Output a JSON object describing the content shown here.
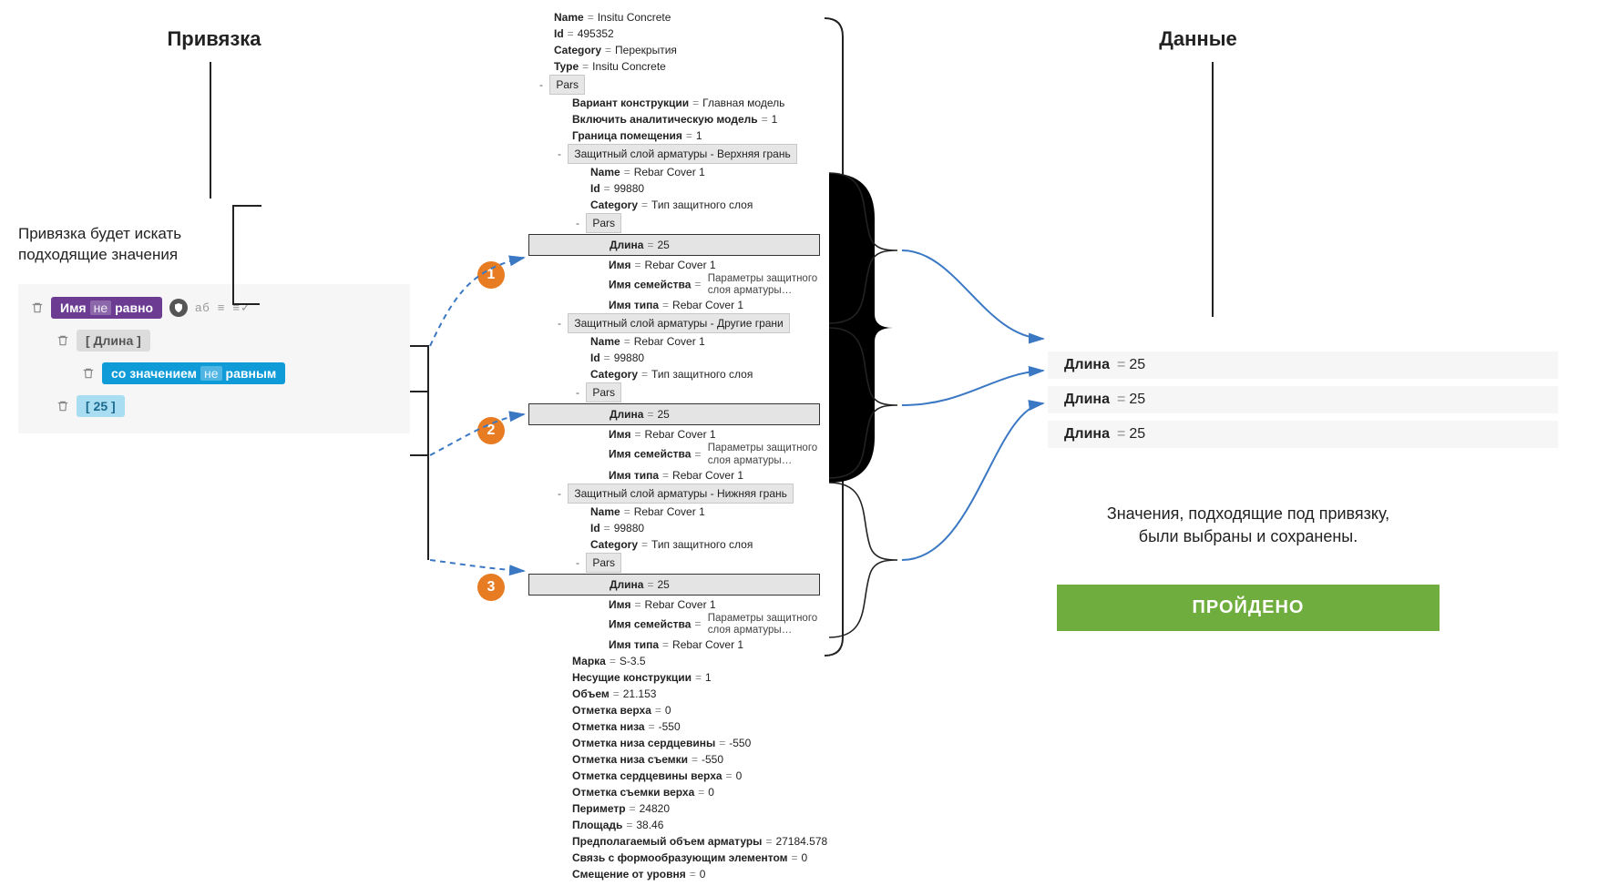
{
  "headings": {
    "left": "Привязка",
    "right": "Данные"
  },
  "leftNote": "Привязка будет искать подходящие  значения",
  "rule": {
    "name_label": "Имя",
    "neg": "не",
    "equals": "равно",
    "icons_hint": "аб",
    "field": "[ Длина ]",
    "withValue": "со значением",
    "withValueEquals": "равным",
    "value": "[ 25 ]"
  },
  "steps": [
    "1",
    "2",
    "3"
  ],
  "tree": {
    "name": {
      "k": "Name",
      "v": "Insitu Concrete"
    },
    "id": {
      "k": "Id",
      "v": "495352"
    },
    "cat": {
      "k": "Category",
      "v": "Перекрытия"
    },
    "type": {
      "k": "Type",
      "v": "Insitu Concrete"
    },
    "pars": "Pars",
    "variant": {
      "k": "Вариант конструкции",
      "v": "Главная модель"
    },
    "analytical": {
      "k": "Включить аналитическую модель",
      "v": "1"
    },
    "room": {
      "k": "Граница помещения",
      "v": "1"
    },
    "groups": [
      {
        "title": "Защитный слой арматуры - Верхняя грань"
      },
      {
        "title": "Защитный слой арматуры - Другие грани"
      },
      {
        "title": "Защитный слой арматуры - Нижняя грань"
      }
    ],
    "groupInner": {
      "name": {
        "k": "Name",
        "v": "Rebar Cover 1"
      },
      "id": {
        "k": "Id",
        "v": "99880"
      },
      "cat": {
        "k": "Category",
        "v": "Тип защитного слоя"
      },
      "pars": "Pars",
      "len": {
        "k": "Длина",
        "v": "25"
      },
      "nm": {
        "k": "Имя",
        "v": "Rebar Cover 1"
      },
      "fam": {
        "k": "Имя семейства",
        "v1": "Параметры защитного",
        "v2": "слоя арматуры…"
      },
      "typename": {
        "k": "Имя типа",
        "v": "Rebar Cover 1"
      }
    },
    "tail": [
      {
        "k": "Марка",
        "v": "S-3.5"
      },
      {
        "k": "Несущие конструкции",
        "v": "1"
      },
      {
        "k": "Объем",
        "v": "21.153"
      },
      {
        "k": "Отметка верха",
        "v": "0"
      },
      {
        "k": "Отметка низа",
        "v": "-550"
      },
      {
        "k": "Отметка низа сердцевины",
        "v": "-550"
      },
      {
        "k": "Отметка низа съемки",
        "v": "-550"
      },
      {
        "k": "Отметка сердцевины верха",
        "v": "0"
      },
      {
        "k": "Отметка съемки верха",
        "v": "0"
      },
      {
        "k": "Периметр",
        "v": "24820"
      },
      {
        "k": "Площадь",
        "v": "38.46"
      },
      {
        "k": "Предполагаемый объем арматуры",
        "v": "27184.578"
      },
      {
        "k": "Связь с формообразующим элементом",
        "v": "0"
      },
      {
        "k": "Смещение от уровня",
        "v": "0"
      }
    ]
  },
  "results": [
    {
      "k": "Длина",
      "v": "25"
    },
    {
      "k": "Длина",
      "v": "25"
    },
    {
      "k": "Длина",
      "v": "25"
    }
  ],
  "rightNote1": "Значения, подходящие под привязку,",
  "rightNote2": "были выбраны и сохранены.",
  "status": "ПРОЙДЕНО"
}
